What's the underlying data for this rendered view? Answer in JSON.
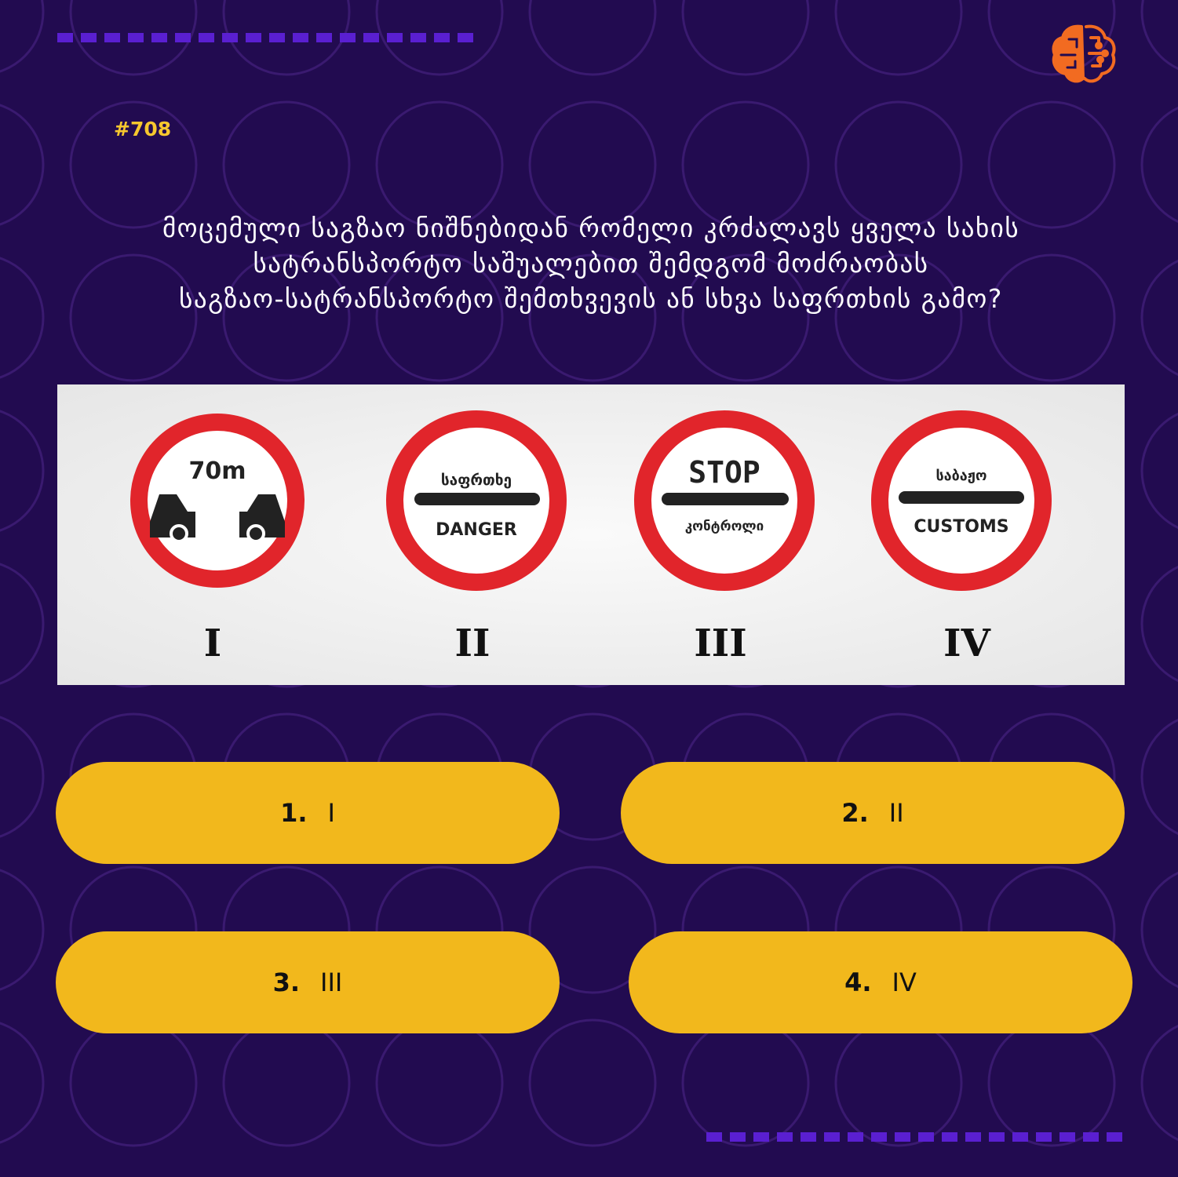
{
  "question_number": "#708",
  "question_lines": [
    "მოცემული საგზაო ნიშნებიდან რომელი კრძალავს ყველა სახის",
    "სატრანსპორტო საშუალებით შემდგომ მოძრაობას",
    "საგზაო-სატრანსპორტო შემთხვევის ან სხვა საფრთხის გამო?"
  ],
  "signs": [
    {
      "numeral": "I",
      "top_text": "70m",
      "bottom_text": ""
    },
    {
      "numeral": "II",
      "top_text": "საფრთხე",
      "bottom_text": "DANGER"
    },
    {
      "numeral": "III",
      "top_text": "STOP",
      "bottom_text": "კონტროლი"
    },
    {
      "numeral": "IV",
      "top_text": "საბაჟო",
      "bottom_text": "CUSTOMS"
    }
  ],
  "answers": [
    {
      "number": "1.",
      "value": "I"
    },
    {
      "number": "2.",
      "value": "II"
    },
    {
      "number": "3.",
      "value": "III"
    },
    {
      "number": "4.",
      "value": "IV"
    }
  ],
  "colors": {
    "background": "#220b50",
    "accent_dash": "#5a1fd1",
    "answer_fill": "#f2b81c",
    "number_yellow": "#f6c72e",
    "logo_orange": "#f26b21",
    "sign_red": "#e1252b"
  },
  "icons": {
    "logo": "brain-circuit-icon",
    "sign_1_vehicles": "two-cars-icon"
  }
}
